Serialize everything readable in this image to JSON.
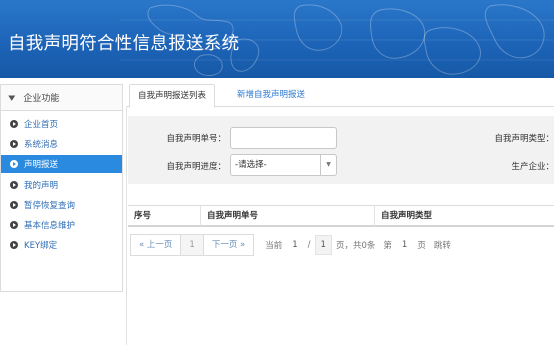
{
  "header": {
    "title": "自我声明符合性信息报送系统"
  },
  "sidebar": {
    "heading": "企业功能",
    "items": [
      {
        "label": "企业首页"
      },
      {
        "label": "系统消息"
      },
      {
        "label": "声明报送",
        "active": true
      },
      {
        "label": "我的声明"
      },
      {
        "label": "暂停恢复查询"
      },
      {
        "label": "基本信息维护"
      },
      {
        "label": "KEY绑定"
      }
    ]
  },
  "tabs": [
    {
      "label": "自我声明报送列表",
      "active": true
    },
    {
      "label": "新增自我声明报送",
      "active": false
    }
  ],
  "filter": {
    "number_label": "自我声明单号：",
    "number_value": "",
    "type_label": "自我声明类型：",
    "progress_label": "自我声明进度：",
    "progress_value": "-请选择-",
    "company_label": "生产企业："
  },
  "table": {
    "columns": [
      "序号",
      "自我声明单号",
      "自我声明类型"
    ]
  },
  "pager": {
    "prev": "« 上一页",
    "page_1": "1",
    "next": "下一页 »",
    "current_label": "当前",
    "current_page": "1",
    "slash": "/",
    "total_pages": "1",
    "summary": "页，共0条",
    "goto_label": "第",
    "goto_page": "1",
    "goto_suffix": "页",
    "jump": "跳转"
  },
  "colors": {
    "header_blue": "#1d64b8",
    "accent": "#2a8ae0",
    "link": "#2e7ad1"
  }
}
